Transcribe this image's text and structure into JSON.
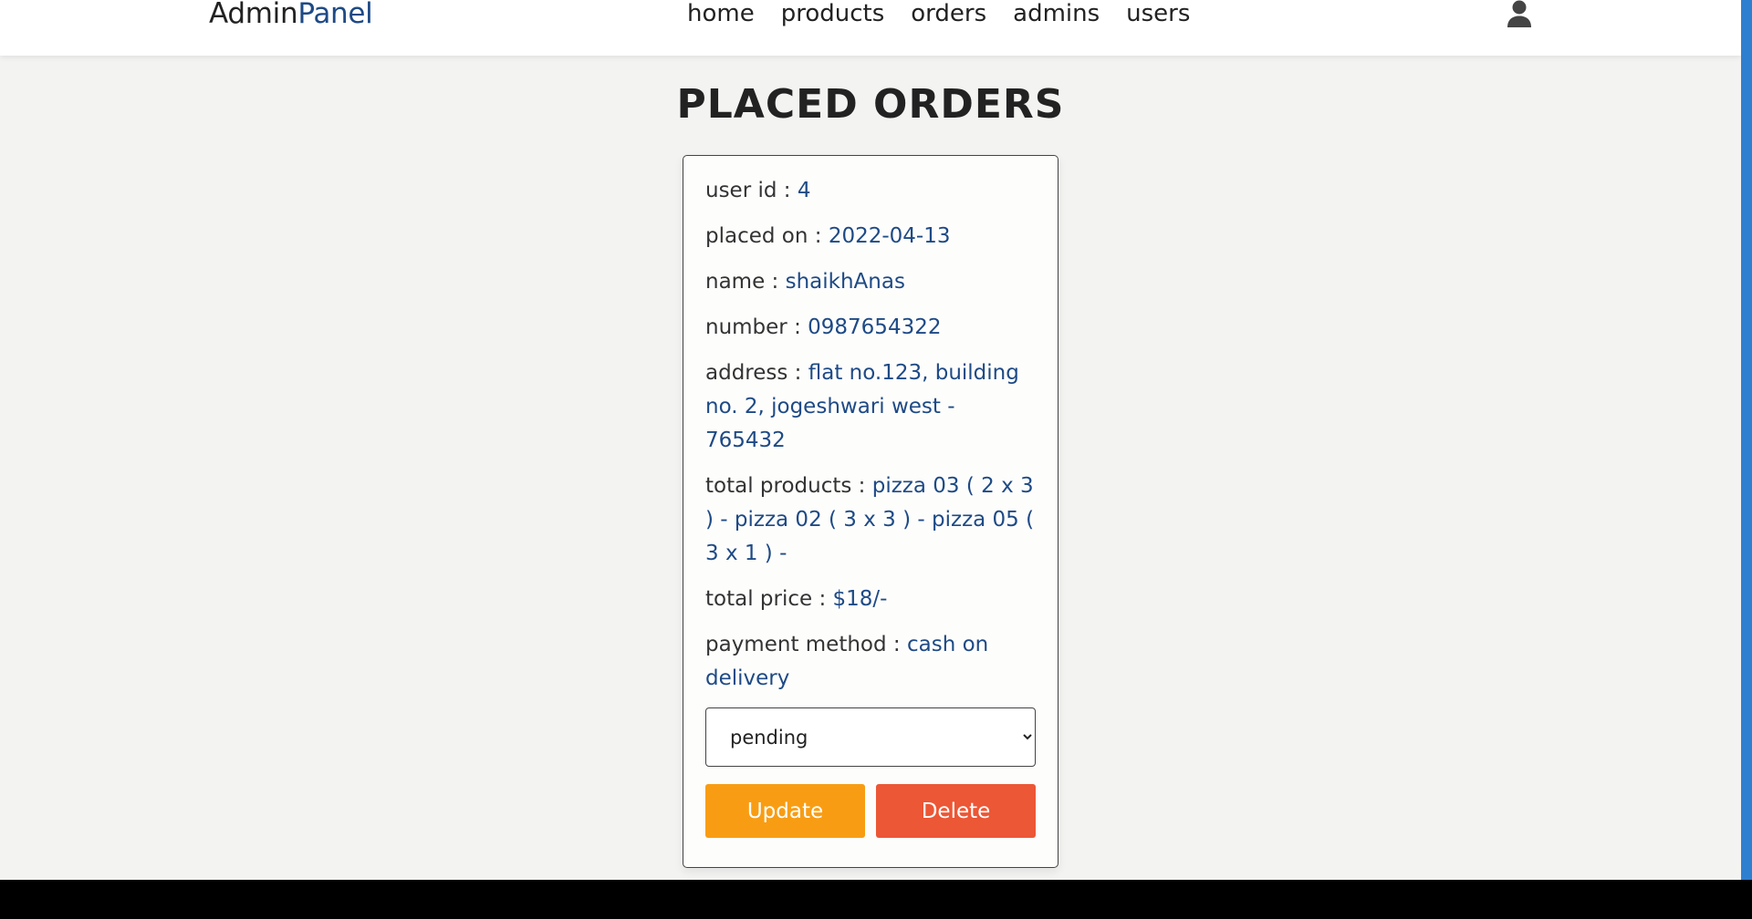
{
  "header": {
    "logo_prefix": "Admin",
    "logo_accent": "Panel",
    "nav": [
      "home",
      "products",
      "orders",
      "admins",
      "users"
    ],
    "user_icon": "user-icon"
  },
  "page": {
    "title": "PLACED ORDERS"
  },
  "order": {
    "fields": [
      {
        "label": "user id : ",
        "value": "4"
      },
      {
        "label": "placed on : ",
        "value": "2022-04-13"
      },
      {
        "label": "name : ",
        "value": "shaikhAnas"
      },
      {
        "label": "number : ",
        "value": "0987654322"
      },
      {
        "label": "address : ",
        "value": "flat no.123, building no. 2, jogeshwari west - 765432"
      },
      {
        "label": "total products : ",
        "value": "pizza 03 ( 2 x 3 ) - pizza 02 ( 3 x 3 ) - pizza 05 ( 3 x 1 ) -"
      },
      {
        "label": "total price : ",
        "value": "$18/-"
      },
      {
        "label": "payment method : ",
        "value": "cash on delivery"
      }
    ],
    "status_selected": "pending",
    "update_label": "Update",
    "delete_label": "Delete"
  },
  "colors": {
    "accent": "#1e4a85",
    "update_button": "#f89d13",
    "delete_button": "#ec5735",
    "side_strip": "#2f7fd1"
  }
}
